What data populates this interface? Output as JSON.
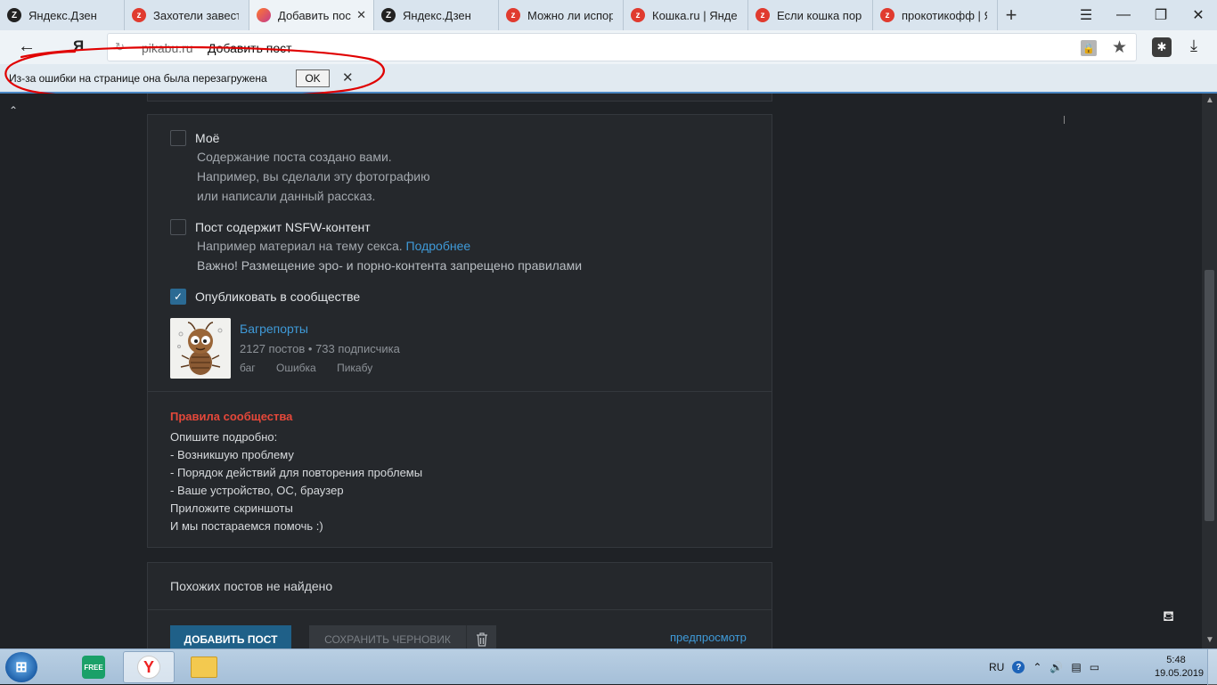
{
  "browser": {
    "tabs": [
      {
        "title": "Яндекс.Дзен",
        "favicon": "dzen-icon",
        "active": false
      },
      {
        "title": "Захотели завести",
        "favicon": "zen-red-icon",
        "active": false
      },
      {
        "title": "Добавить пос",
        "favicon": "pikabu-icon",
        "active": true
      },
      {
        "title": "Яндекс.Дзен",
        "favicon": "dzen-icon",
        "active": false
      },
      {
        "title": "Можно ли испор",
        "favicon": "zen-red-icon",
        "active": false
      },
      {
        "title": "Кошка.ru | Яндек",
        "favicon": "zen-red-icon",
        "active": false
      },
      {
        "title": "Если кошка пор",
        "favicon": "zen-red-icon",
        "active": false
      },
      {
        "title": "прокотикофф | Я",
        "favicon": "zen-red-icon",
        "active": false
      }
    ],
    "url_domain": "pikabu.ru",
    "url_title": "Добавить пост",
    "yandex_letter": "Я"
  },
  "infobar": {
    "message": "Из-за ошибки на странице она была перезагружена",
    "ok_label": "OK"
  },
  "form": {
    "mine": {
      "label": "Моё",
      "checked": false,
      "hint_lines": [
        "Содержание поста создано вами.",
        "Например, вы сделали эту фотографию",
        "или написали данный рассказ."
      ]
    },
    "nsfw": {
      "label": "Пост содержит NSFW-контент",
      "checked": false,
      "hint_line1": "Например материал на тему секса.",
      "hint_link": "Подробнее",
      "hint_warn_bold": "Важно!",
      "hint_warn_rest": "Размещение эро- и порно-контента запрещено правилами"
    },
    "community_publish": {
      "label": "Опубликовать в сообществе",
      "checked": true
    },
    "community": {
      "name": "Багрепорты",
      "posts": "2127 постов",
      "separator": "•",
      "subscribers": "733 подписчика",
      "tags": [
        "баг",
        "Ошибка",
        "Пикабу"
      ]
    },
    "rules": {
      "title": "Правила сообщества",
      "lines": [
        "Опишите подробно:",
        "- Возникшую проблему",
        "- Порядок действий для повторения проблемы",
        "- Ваше устройство, ОС, браузер",
        "Приложите скриншоты",
        "И мы постараемся помочь :)"
      ]
    }
  },
  "similar": {
    "text": "Похожих постов не найдено"
  },
  "actions": {
    "add_label": "ДОБАВИТЬ ПОСТ",
    "draft_label": "СОХРАНИТЬ ЧЕРНОВИК",
    "preview_label": "предпросмотр"
  },
  "taskbar": {
    "lang": "RU",
    "time": "5:48",
    "date": "19.05.2019",
    "kaspersky_label": "FREE"
  },
  "colors": {
    "page_bg": "#1f2226",
    "card_bg": "#25282c",
    "accent_blue": "#3f9ad8",
    "rules_red": "#e5483a",
    "button_blue": "#1f6088",
    "annotation_red": "#e00000"
  }
}
